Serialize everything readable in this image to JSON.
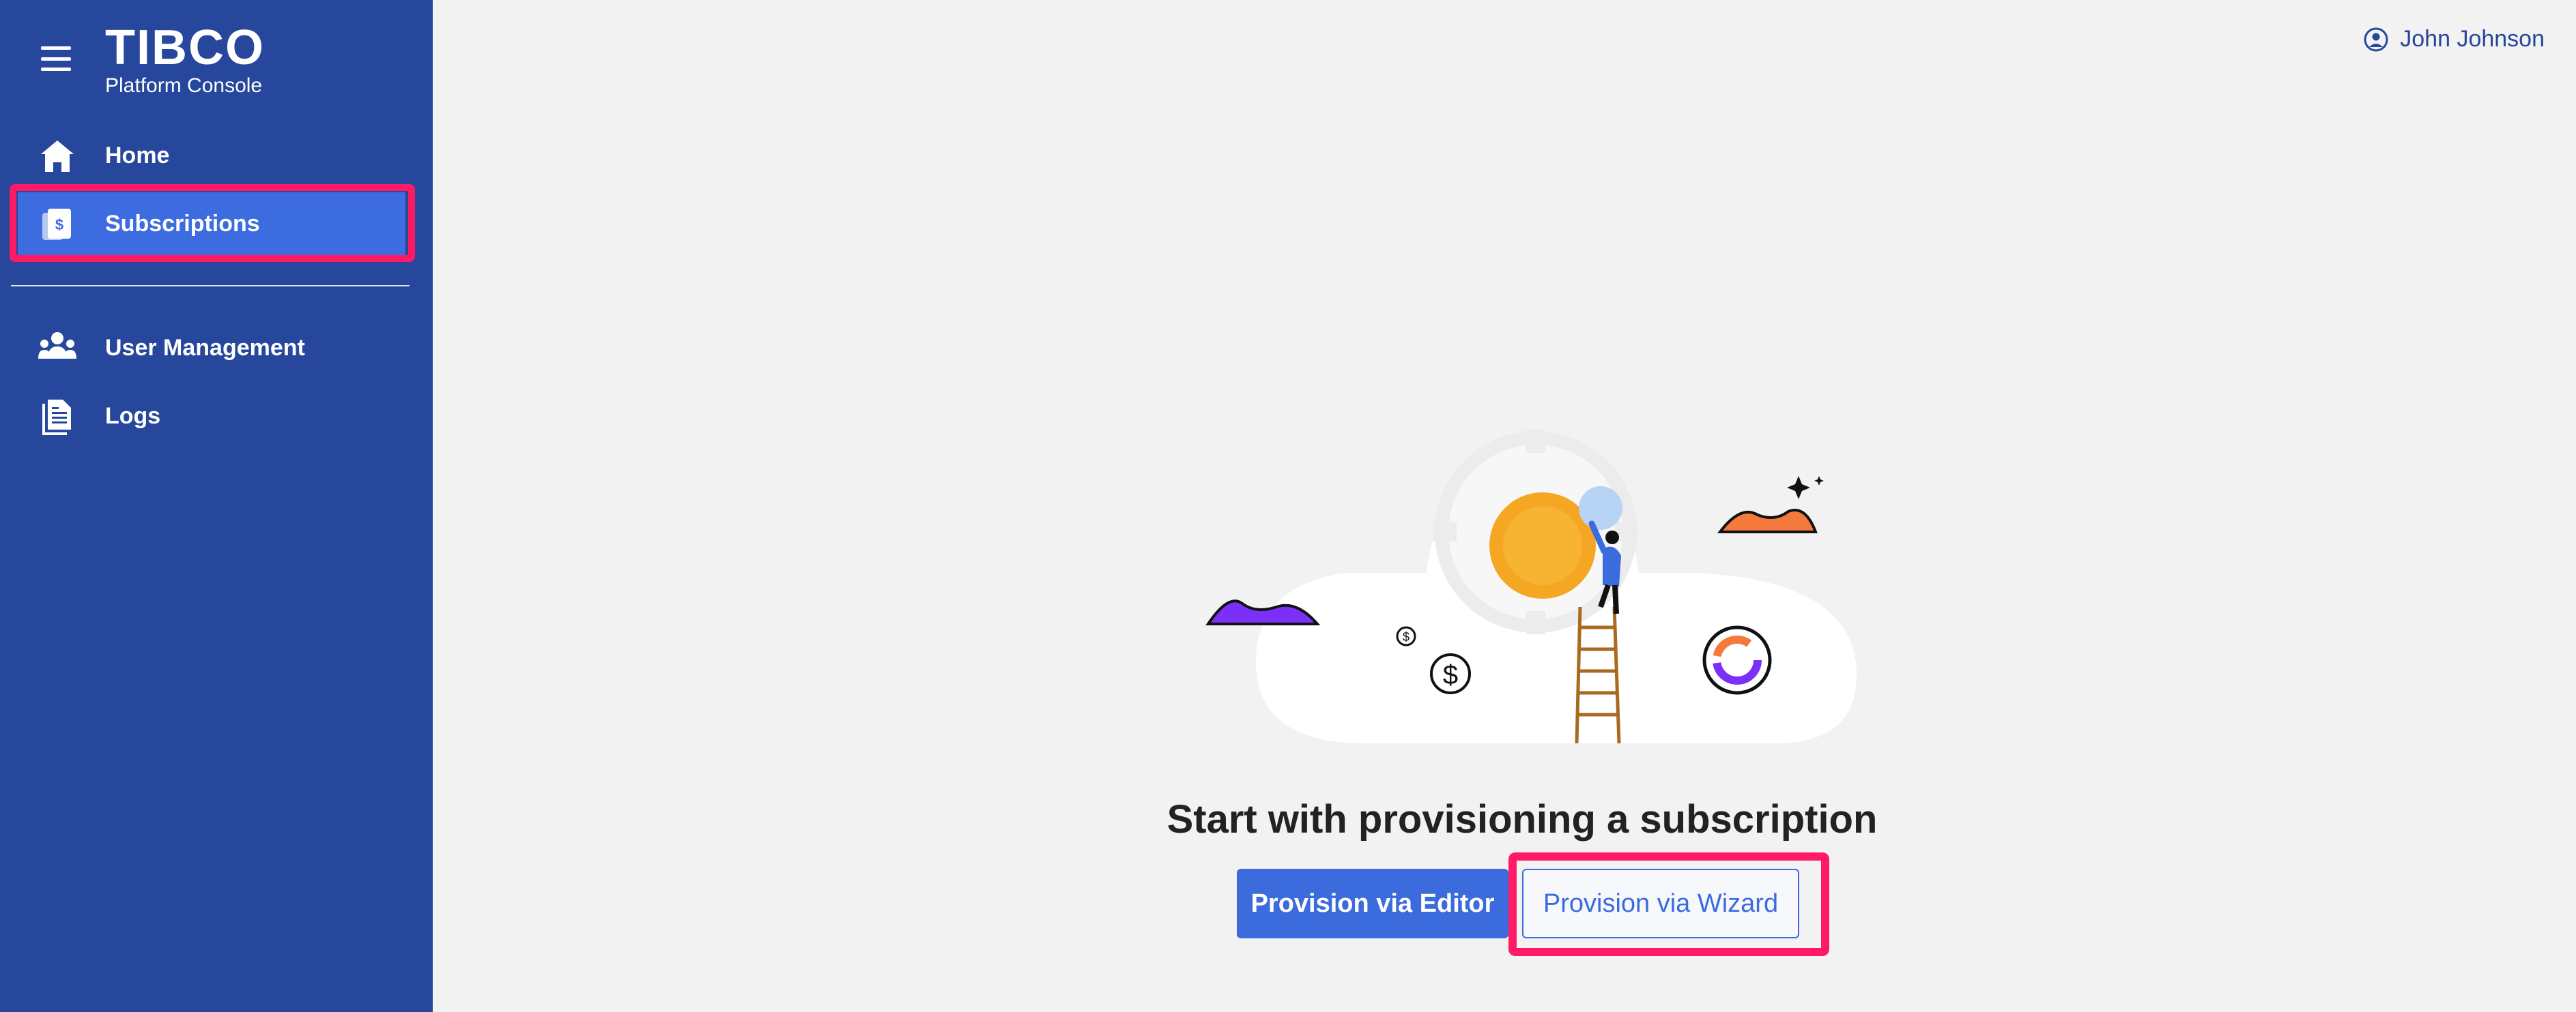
{
  "brand": {
    "logo": "TIBCO",
    "product": "Platform Console"
  },
  "sidebar": {
    "items": [
      {
        "label": "Home",
        "icon": "home-icon"
      },
      {
        "label": "Subscriptions",
        "icon": "subscription-icon",
        "active": true
      },
      {
        "label": "User Management",
        "icon": "users-icon"
      },
      {
        "label": "Logs",
        "icon": "logs-icon"
      }
    ]
  },
  "header": {
    "user_name": "John Johnson",
    "user_icon": "user-circle-icon"
  },
  "main": {
    "headline": "Start with provisioning a subscription",
    "primary_button": "Provision via Editor",
    "secondary_button": "Provision via Wizard"
  },
  "colors": {
    "sidebar_bg": "#26479c",
    "active_item_bg": "#3d6be0",
    "primary": "#3b6bdc",
    "highlight": "#ff1a66",
    "page_bg": "#f2f2f2"
  }
}
